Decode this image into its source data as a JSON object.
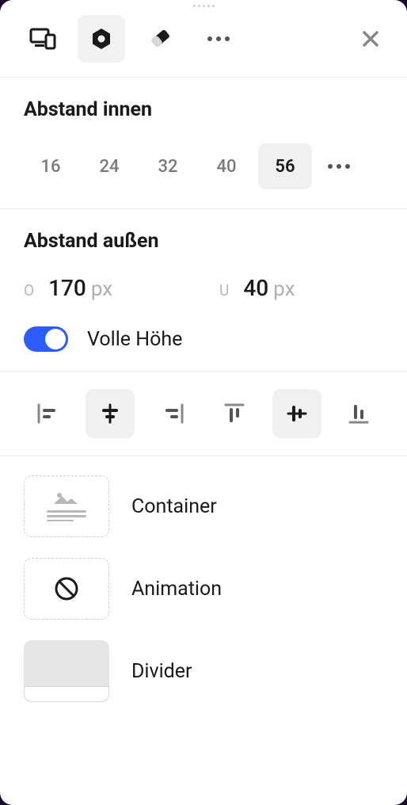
{
  "sections": {
    "padding": {
      "title": "Abstand innen",
      "presets": [
        "16",
        "24",
        "32",
        "40",
        "56"
      ],
      "selected": "56"
    },
    "margin": {
      "title": "Abstand außen",
      "top": {
        "label": "O",
        "value": "170",
        "unit": "px"
      },
      "bottom": {
        "label": "U",
        "value": "40",
        "unit": "px"
      },
      "fullHeight": {
        "label": "Volle Höhe",
        "on": true
      }
    }
  },
  "elements": {
    "container": "Container",
    "animation": "Animation",
    "divider": "Divider"
  }
}
